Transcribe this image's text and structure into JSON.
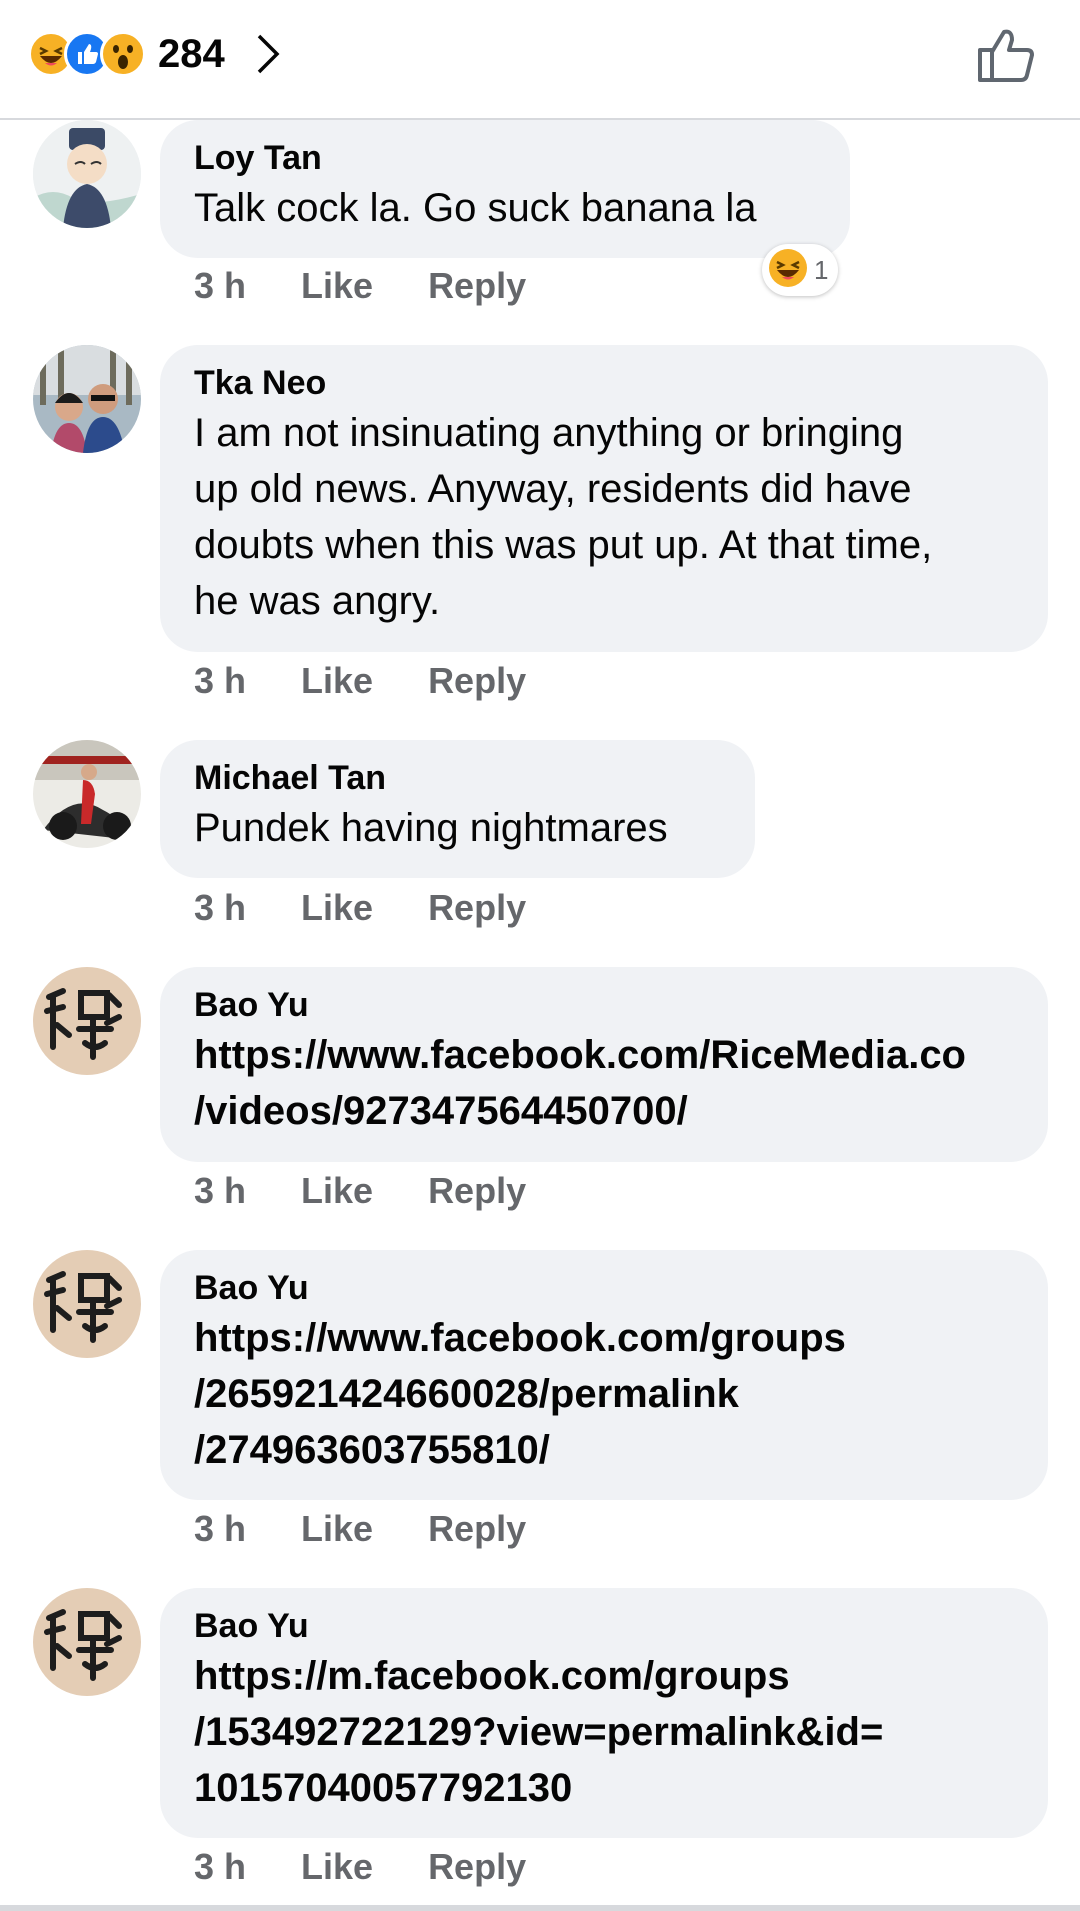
{
  "header": {
    "reaction_icons": [
      "haha-icon",
      "like-icon",
      "wow-icon"
    ],
    "reaction_count": "284",
    "chevron_icon": "chevron-right-icon",
    "like_icon": "thumbs-up-icon"
  },
  "comments": [
    {
      "name": "Loy Tan",
      "text": "Talk cock la. Go suck banana la",
      "time": "3 h",
      "like": "Like",
      "reply": "Reply",
      "reaction": {
        "icon": "haha-icon",
        "count": "1"
      }
    },
    {
      "name": "Tka Neo",
      "text": "I am not insinuating anything or bringing\nup old news. Anyway, residents did have\ndoubts when this was put up. At that time,\nhe was angry.",
      "time": "3 h",
      "like": "Like",
      "reply": "Reply"
    },
    {
      "name": "Michael Tan",
      "text": "Pundek having nightmares",
      "time": "3 h",
      "like": "Like",
      "reply": "Reply"
    },
    {
      "name": "Bao Yu",
      "text": "https://www.facebook.com/RiceMedia.co\n/videos/927347564450700/",
      "time": "3 h",
      "like": "Like",
      "reply": "Reply"
    },
    {
      "name": "Bao Yu",
      "text": "https://www.facebook.com/groups\n/265921424660028/permalink\n/274963603755810/",
      "time": "3 h",
      "like": "Like",
      "reply": "Reply"
    },
    {
      "name": "Bao Yu",
      "text": "https://m.facebook.com/groups\n/153492722129?view=permalink&id=\n10157040057792130",
      "time": "3 h",
      "like": "Like",
      "reply": "Reply"
    }
  ],
  "colors": {
    "bubble": "#f0f2f5",
    "meta_text": "#65676b",
    "like_blue": "#1877f2",
    "emoji_yellow": "#f7b125"
  }
}
